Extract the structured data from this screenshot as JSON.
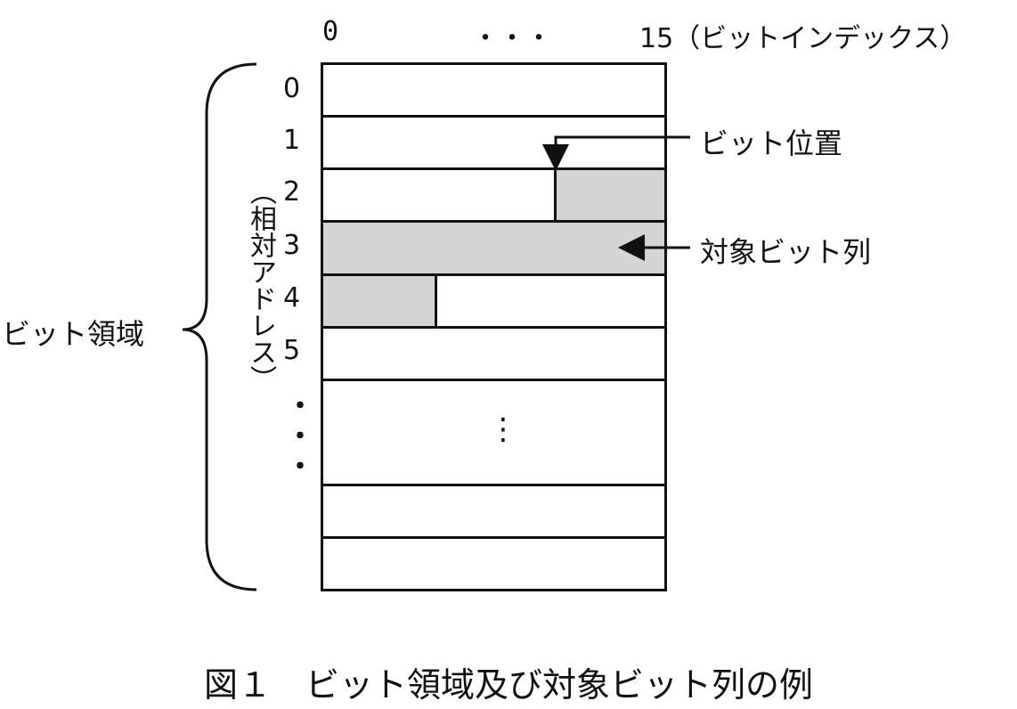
{
  "header": {
    "index_start": "0",
    "index_ellipsis": "・・・",
    "index_end": "15（ビットインデックス）"
  },
  "rows": {
    "labels": [
      "0",
      "1",
      "2",
      "3",
      "4",
      "5"
    ],
    "ellipsis_inner": "⋮",
    "ellipsis_left": [
      "・",
      "・",
      "・"
    ]
  },
  "axis": {
    "relative_address": "（相対アドレス）"
  },
  "brace": {
    "label": "ビット領域"
  },
  "callouts": {
    "bit_position": "ビット位置",
    "target_bit_string": "対象ビット列"
  },
  "caption": "図１　ビット領域及び対象ビット列の例",
  "colors": {
    "line": "#111111",
    "shade": "#d4d4d4"
  }
}
